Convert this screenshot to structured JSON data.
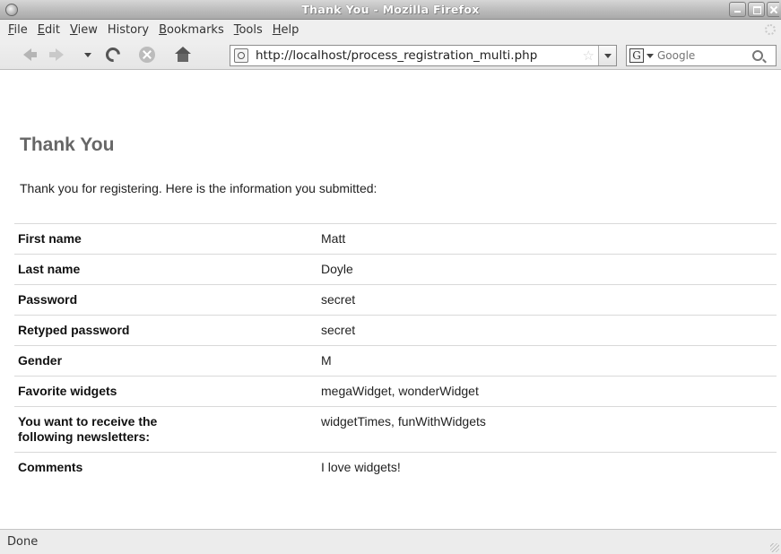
{
  "window": {
    "title": "Thank You - Mozilla Firefox"
  },
  "menu": {
    "items": [
      {
        "key": "F",
        "rest": "ile"
      },
      {
        "key": "E",
        "rest": "dit"
      },
      {
        "key": "V",
        "rest": "iew"
      },
      {
        "key": "",
        "rest": "History"
      },
      {
        "key": "B",
        "rest": "ookmarks"
      },
      {
        "key": "T",
        "rest": "ools"
      },
      {
        "key": "H",
        "rest": "elp"
      }
    ]
  },
  "toolbar": {
    "url": "http://localhost/process_registration_multi.php",
    "search_placeholder": "Google",
    "search_engine_letter": "G"
  },
  "page": {
    "title": "Thank You",
    "intro": "Thank you for registering. Here is the information you submitted:",
    "rows": [
      {
        "label": "First name",
        "value": "Matt"
      },
      {
        "label": "Last name",
        "value": "Doyle"
      },
      {
        "label": "Password",
        "value": "secret"
      },
      {
        "label": "Retyped password",
        "value": "secret"
      },
      {
        "label": "Gender",
        "value": "M"
      },
      {
        "label": "Favorite widgets",
        "value": "megaWidget, wonderWidget"
      },
      {
        "label": "You want to receive the following newsletters:",
        "value": "widgetTimes, funWithWidgets"
      },
      {
        "label": "Comments",
        "value": "I love widgets!"
      }
    ]
  },
  "status": {
    "text": "Done"
  }
}
